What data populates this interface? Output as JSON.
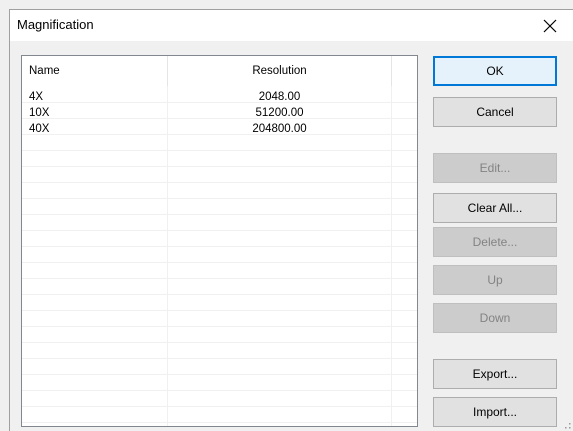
{
  "dialog": {
    "title": "Magnification",
    "close_glyph": "✕"
  },
  "list": {
    "columns": [
      "Name",
      "Resolution"
    ],
    "rows": [
      {
        "name": "4X",
        "resolution": "2048.00"
      },
      {
        "name": "10X",
        "resolution": "51200.00"
      },
      {
        "name": "40X",
        "resolution": "204800.00"
      }
    ]
  },
  "buttons": {
    "ok": {
      "label": "OK",
      "enabled": true
    },
    "cancel": {
      "label": "Cancel",
      "enabled": true
    },
    "edit": {
      "label": "Edit...",
      "enabled": false
    },
    "clear_all": {
      "label": "Clear All...",
      "enabled": true
    },
    "delete": {
      "label": "Delete...",
      "enabled": false
    },
    "up": {
      "label": "Up",
      "enabled": false
    },
    "down": {
      "label": "Down",
      "enabled": false
    },
    "export": {
      "label": "Export...",
      "enabled": true
    },
    "import": {
      "label": "Import...",
      "enabled": true
    }
  },
  "colors": {
    "dialog_bg": "#f0f0f0",
    "default_button_border": "#0078d7",
    "disabled_text": "#838383"
  },
  "icons": {
    "close": "close-icon",
    "resize": "resize-grip-icon"
  }
}
